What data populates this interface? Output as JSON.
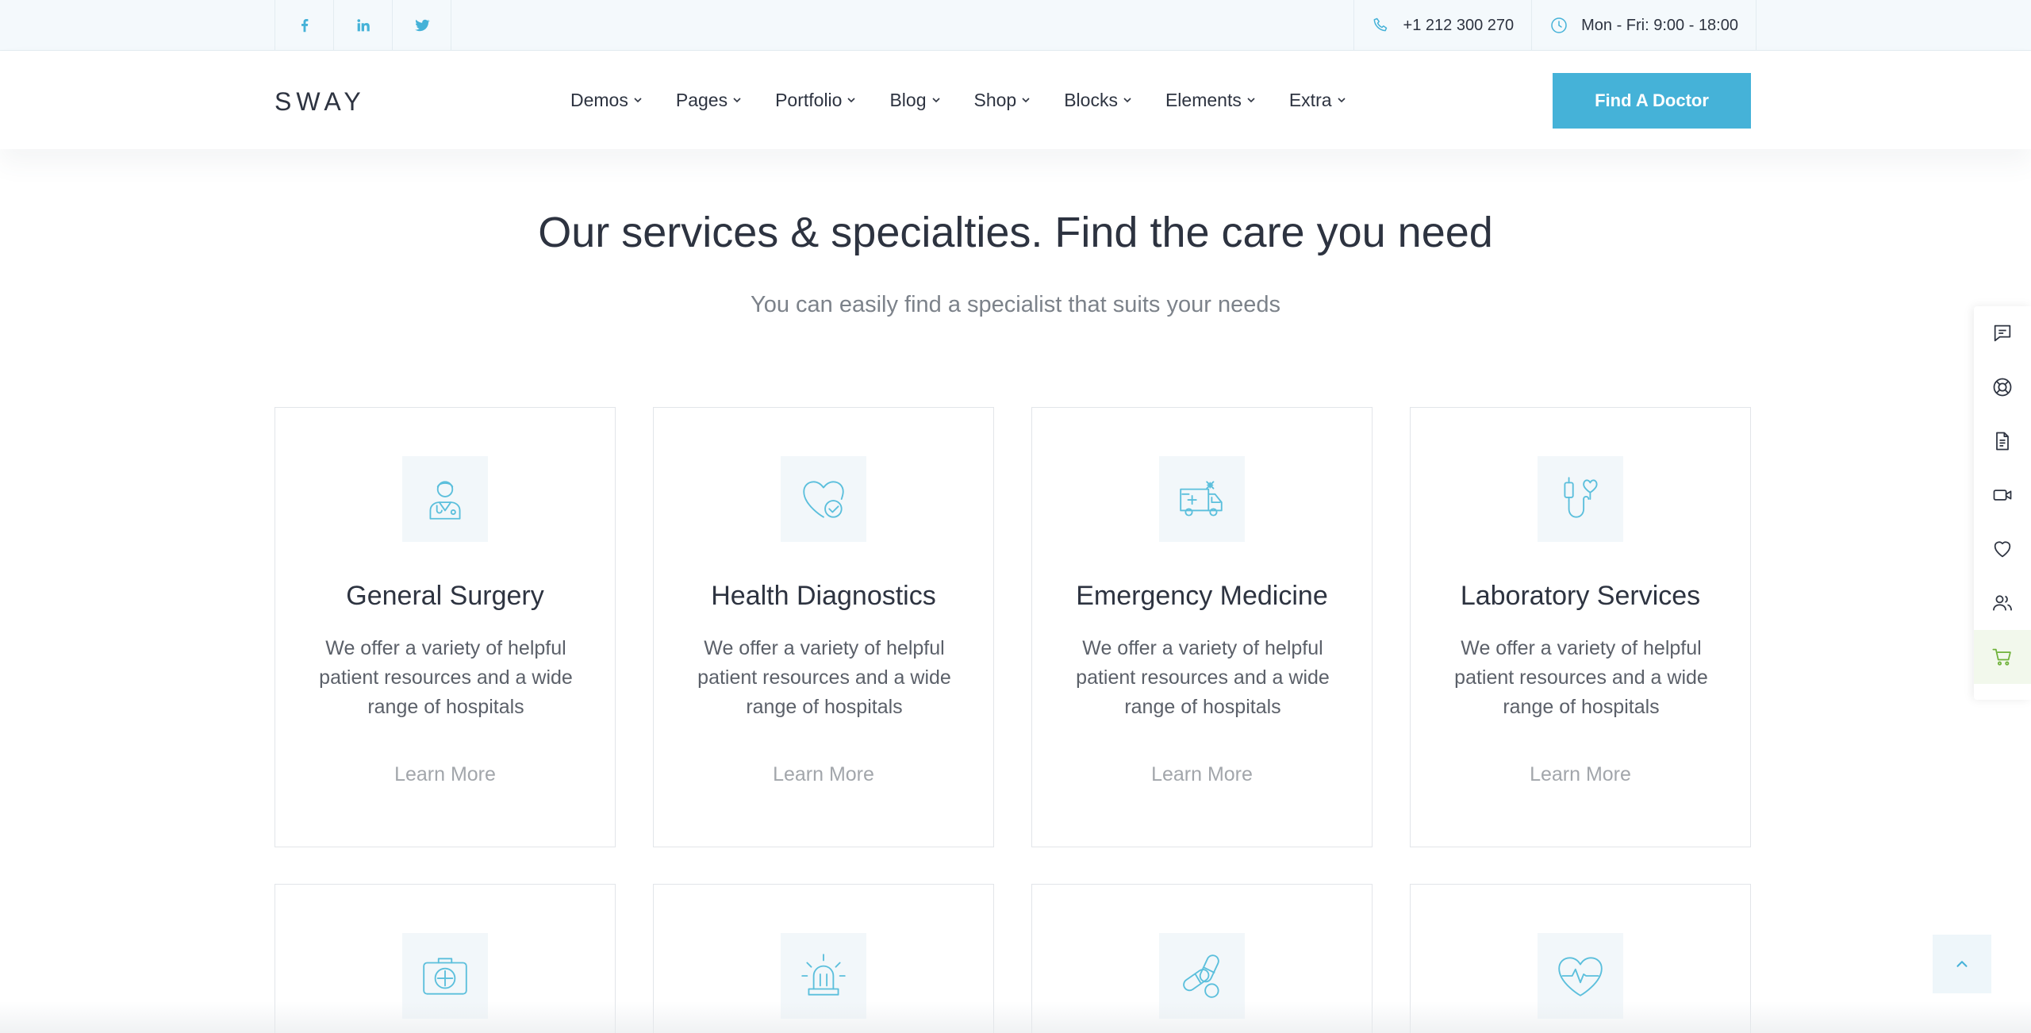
{
  "colors": {
    "accent": "#45b2d8",
    "text": "#2d3340",
    "muted": "#7c828a",
    "link": "#a2a6ab",
    "icon": "#5bbfdc"
  },
  "topbar": {
    "social": [
      {
        "icon": "facebook-icon"
      },
      {
        "icon": "linkedin-icon"
      },
      {
        "icon": "twitter-icon"
      }
    ],
    "phone": "+1 212 300 270",
    "hours": "Mon - Fri: 9:00 - 18:00"
  },
  "header": {
    "logo": "SWAY",
    "nav": [
      "Demos",
      "Pages",
      "Portfolio",
      "Blog",
      "Shop",
      "Blocks",
      "Elements",
      "Extra"
    ],
    "cta": "Find A Doctor"
  },
  "section": {
    "title": "Our services & specialties. Find the care you need",
    "subtitle": "You can easily find a specialist that suits your needs"
  },
  "cards": [
    {
      "icon": "doctor-icon",
      "title": "General Surgery",
      "text": "We offer a variety of helpful patient resources and a wide range of hospitals",
      "link": "Learn More"
    },
    {
      "icon": "heart-check-icon",
      "title": "Health Diagnostics",
      "text": "We offer a variety of helpful patient resources and a wide range of hospitals",
      "link": "Learn More"
    },
    {
      "icon": "ambulance-icon",
      "title": "Emergency Medicine",
      "text": "We offer a variety of helpful patient resources and a wide range of hospitals",
      "link": "Learn More"
    },
    {
      "icon": "stethoscope-icon",
      "title": "Laboratory Services",
      "text": "We offer a variety of helpful patient resources and a wide range of hospitals",
      "link": "Learn More"
    }
  ],
  "cards_row2": [
    {
      "icon": "first-aid-kit-icon"
    },
    {
      "icon": "siren-icon"
    },
    {
      "icon": "pills-icon"
    },
    {
      "icon": "heartbeat-icon"
    }
  ],
  "side_toolbar": [
    "chat-icon",
    "support-icon",
    "document-icon",
    "video-icon",
    "heart-icon",
    "users-icon",
    "cart-icon"
  ]
}
